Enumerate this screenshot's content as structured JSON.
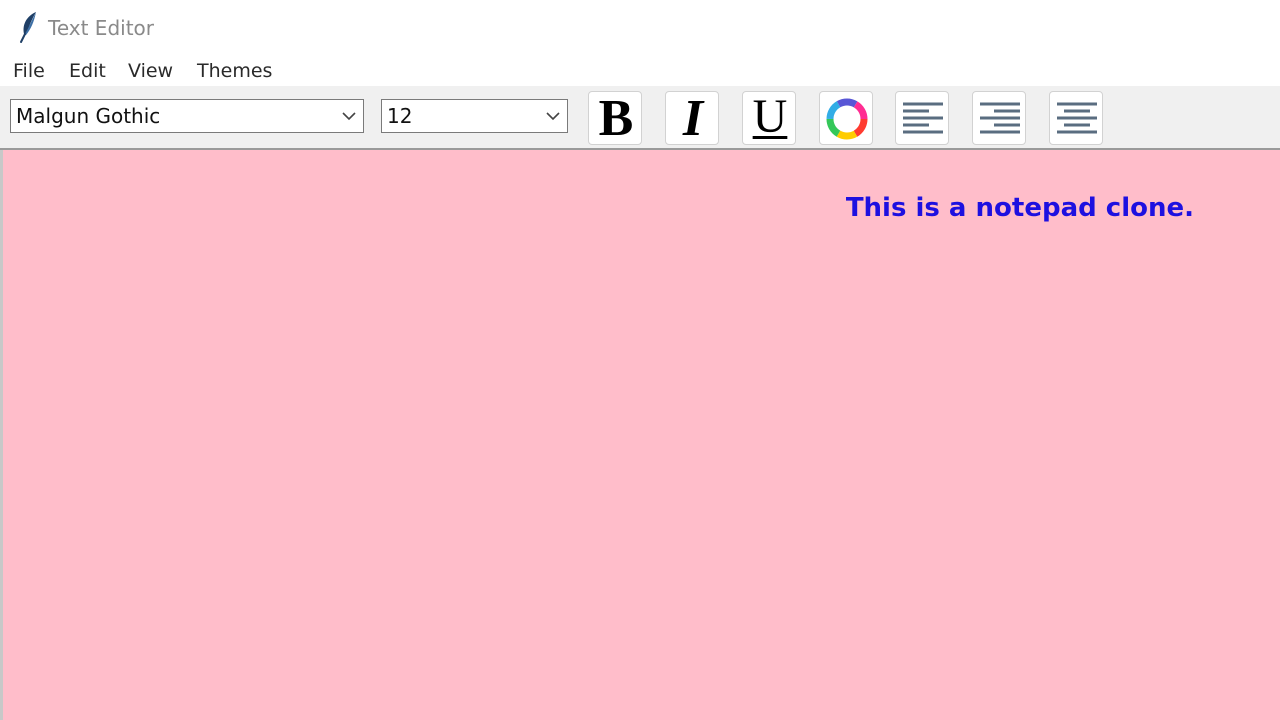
{
  "window": {
    "title": "Text Editor",
    "icon": "feather-icon"
  },
  "menu": {
    "file": "File",
    "edit": "Edit",
    "view": "View",
    "themes": "Themes"
  },
  "toolbar": {
    "font_family": "Malgun Gothic",
    "font_size": "12",
    "bold_label": "B",
    "italic_label": "I",
    "underline_label": "U",
    "color_icon": "color-wheel-icon",
    "align_left_icon": "align-left-icon",
    "align_right_icon": "align-right-icon",
    "align_center_icon": "align-center-icon"
  },
  "editor": {
    "content": "This is a notepad clone.",
    "background_color": "#ffbdca",
    "text_color": "#1d10e0",
    "alignment": "right"
  }
}
